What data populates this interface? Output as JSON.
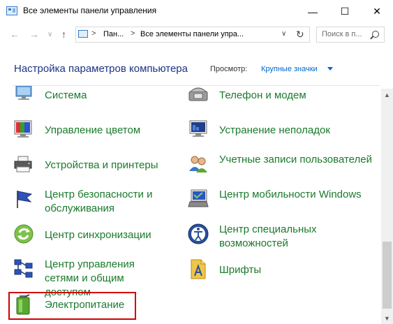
{
  "window": {
    "title": "Все элементы панели управления",
    "controls": {
      "minimize": "—",
      "maximize": "☐",
      "close": "✕"
    }
  },
  "addressbar": {
    "back": "←",
    "forward": "→",
    "dropdown": "∨",
    "up": "↑",
    "crumbs": [
      "Пан...",
      "Все элементы панели упра..."
    ],
    "separator": ">",
    "crumb_dropdown": "∨",
    "refresh": "↻",
    "search_placeholder": "Поиск в п..."
  },
  "header": {
    "title": "Настройка параметров компьютера",
    "view_label": "Просмотр:",
    "view_value": "Крупные значки"
  },
  "scrollbar": {
    "up": "▲",
    "down": "▼"
  },
  "items_left": [
    {
      "label": "Система",
      "icon": "system-icon"
    },
    {
      "label": "Управление цветом",
      "icon": "color-management-icon"
    },
    {
      "label": "Устройства и принтеры",
      "icon": "printer-icon"
    },
    {
      "label": "Центр безопасности и обслуживания",
      "icon": "flag-icon"
    },
    {
      "label": "Центр синхронизации",
      "icon": "sync-icon"
    },
    {
      "label": "Центр управления сетями и общим доступом",
      "icon": "network-icon"
    },
    {
      "label": "Электропитание",
      "icon": "battery-icon"
    }
  ],
  "items_right": [
    {
      "label": "Телефон и модем",
      "icon": "phone-icon"
    },
    {
      "label": "Устранение неполадок",
      "icon": "troubleshoot-icon"
    },
    {
      "label": "Учетные записи пользователей",
      "icon": "users-icon"
    },
    {
      "label": "Центр мобильности Windows",
      "icon": "mobility-icon"
    },
    {
      "label": "Центр специальных возможностей",
      "icon": "accessibility-icon"
    },
    {
      "label": "Шрифты",
      "icon": "fonts-icon"
    }
  ],
  "colors": {
    "link_green": "#1a7a2c",
    "header_blue": "#1e3287",
    "highlight_red": "#d10000"
  }
}
